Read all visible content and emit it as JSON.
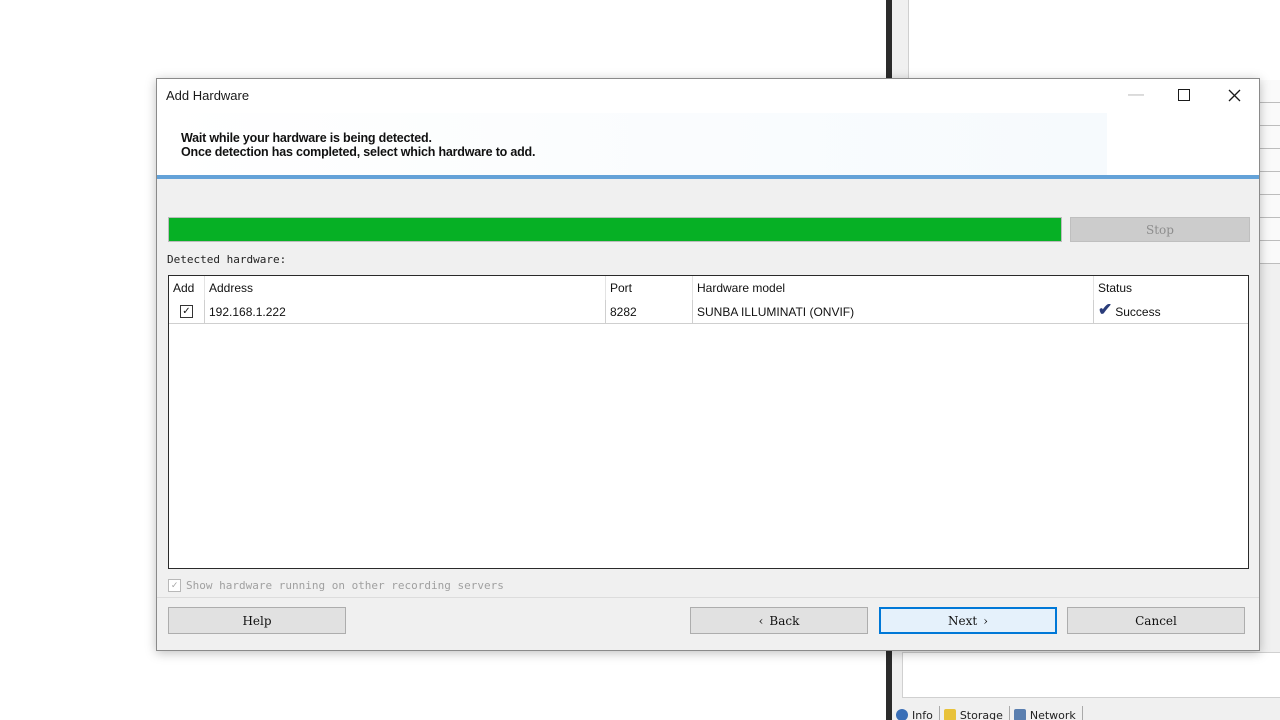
{
  "dialog": {
    "title": "Add Hardware",
    "header_line1": "Wait while your hardware is being detected.",
    "header_line2": "Once detection has completed, select which hardware to add."
  },
  "progress": {
    "value": 1.0,
    "color": "#06b025"
  },
  "stop_label": "Stop",
  "detected_label": "Detected hardware:",
  "table": {
    "columns": [
      "Add",
      "Address",
      "Port",
      "Hardware model",
      "Status"
    ],
    "rows": [
      {
        "add": true,
        "address": "192.168.1.222",
        "port": "8282",
        "model": "SUNBA ILLUMINATI (ONVIF)",
        "status": "Success"
      }
    ]
  },
  "show_other_label": "Show hardware running on other recording servers",
  "buttons": {
    "help": "Help",
    "back": "Back",
    "next": "Next",
    "cancel": "Cancel"
  },
  "background_tabs": [
    "Info",
    "Storage",
    "Network"
  ],
  "icons": {
    "minimize": "minimize-icon",
    "maximize": "maximize-icon",
    "close": "close-icon",
    "status_ok": "checkmark-icon"
  },
  "colors": {
    "accent_line": "#64a2d8",
    "focus_border": "#0078d7",
    "check_color": "#2a3c7a"
  }
}
